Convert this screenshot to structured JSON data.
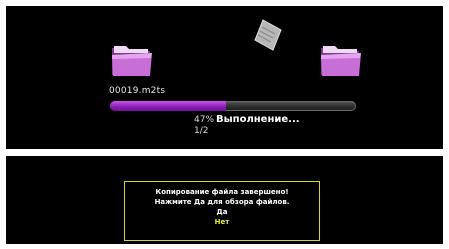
{
  "copy_progress": {
    "filename": "00019.m2ts",
    "percent_label": "47%",
    "progress_fraction": 0.47,
    "status": "Выполнение...",
    "counter": "1/2",
    "icons": {
      "source": "folder-icon",
      "destination": "folder-icon",
      "moving_file": "document-icon"
    },
    "colors": {
      "progress_fill": "#9b2fcc",
      "folder": "#c76fd6"
    }
  },
  "dialog": {
    "line1": "Копирование файла завершено!",
    "line2": "Нажмите Да для обзора файлов.",
    "yes_label": "Да",
    "no_label": "Нет",
    "colors": {
      "border": "#d6d23a",
      "selected_option": "#e8e84a"
    }
  }
}
